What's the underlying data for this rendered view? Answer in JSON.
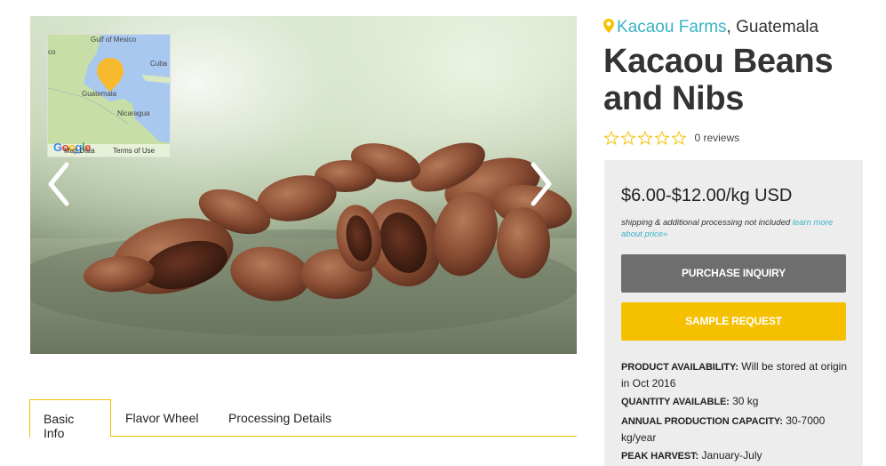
{
  "gallery": {
    "prev_icon": "chevron-left-icon",
    "next_icon": "chevron-right-icon"
  },
  "map": {
    "labels": {
      "gulf": "Gulf of Mexico",
      "cuba": "Cuba",
      "guatemala": "Guatemala",
      "nicaragua": "Nicaragua",
      "co": "co"
    },
    "google": "Google",
    "map_data": "Map Data",
    "terms": "Terms of Use"
  },
  "tabs": [
    {
      "label": "Basic Info",
      "active": true
    },
    {
      "label": "Flavor Wheel",
      "active": false
    },
    {
      "label": "Processing Details",
      "active": false
    }
  ],
  "product": {
    "farm": "Kacaou Farms",
    "country_suffix": ", Guatemala",
    "title": "Kacaou Beans and Nibs",
    "rating_stars": 0,
    "reviews": "0 reviews",
    "price": "$6.00-$12.00/kg USD",
    "shipping_note": "shipping & additional processing not included",
    "learn_more": "learn more about price»",
    "purchase_button": "PURCHASE INQUIRY",
    "sample_button": "SAMPLE REQUEST",
    "specs": {
      "availability_label": "PRODUCT AVAILABILITY:",
      "availability_value": "Will be stored at origin in Oct 2016",
      "quantity_label": "QUANTITY AVAILABLE:",
      "quantity_value": "30 kg",
      "capacity_label": "ANNUAL PRODUCTION CAPACITY:",
      "capacity_value": "30-7000 kg/year",
      "harvest_label": "PEAK HARVEST:",
      "harvest_value": "January-July"
    }
  },
  "colors": {
    "accent_teal": "#3ab3c7",
    "accent_yellow": "#f5c000",
    "button_gray": "#6e6e6e",
    "panel_bg": "#ededed"
  }
}
